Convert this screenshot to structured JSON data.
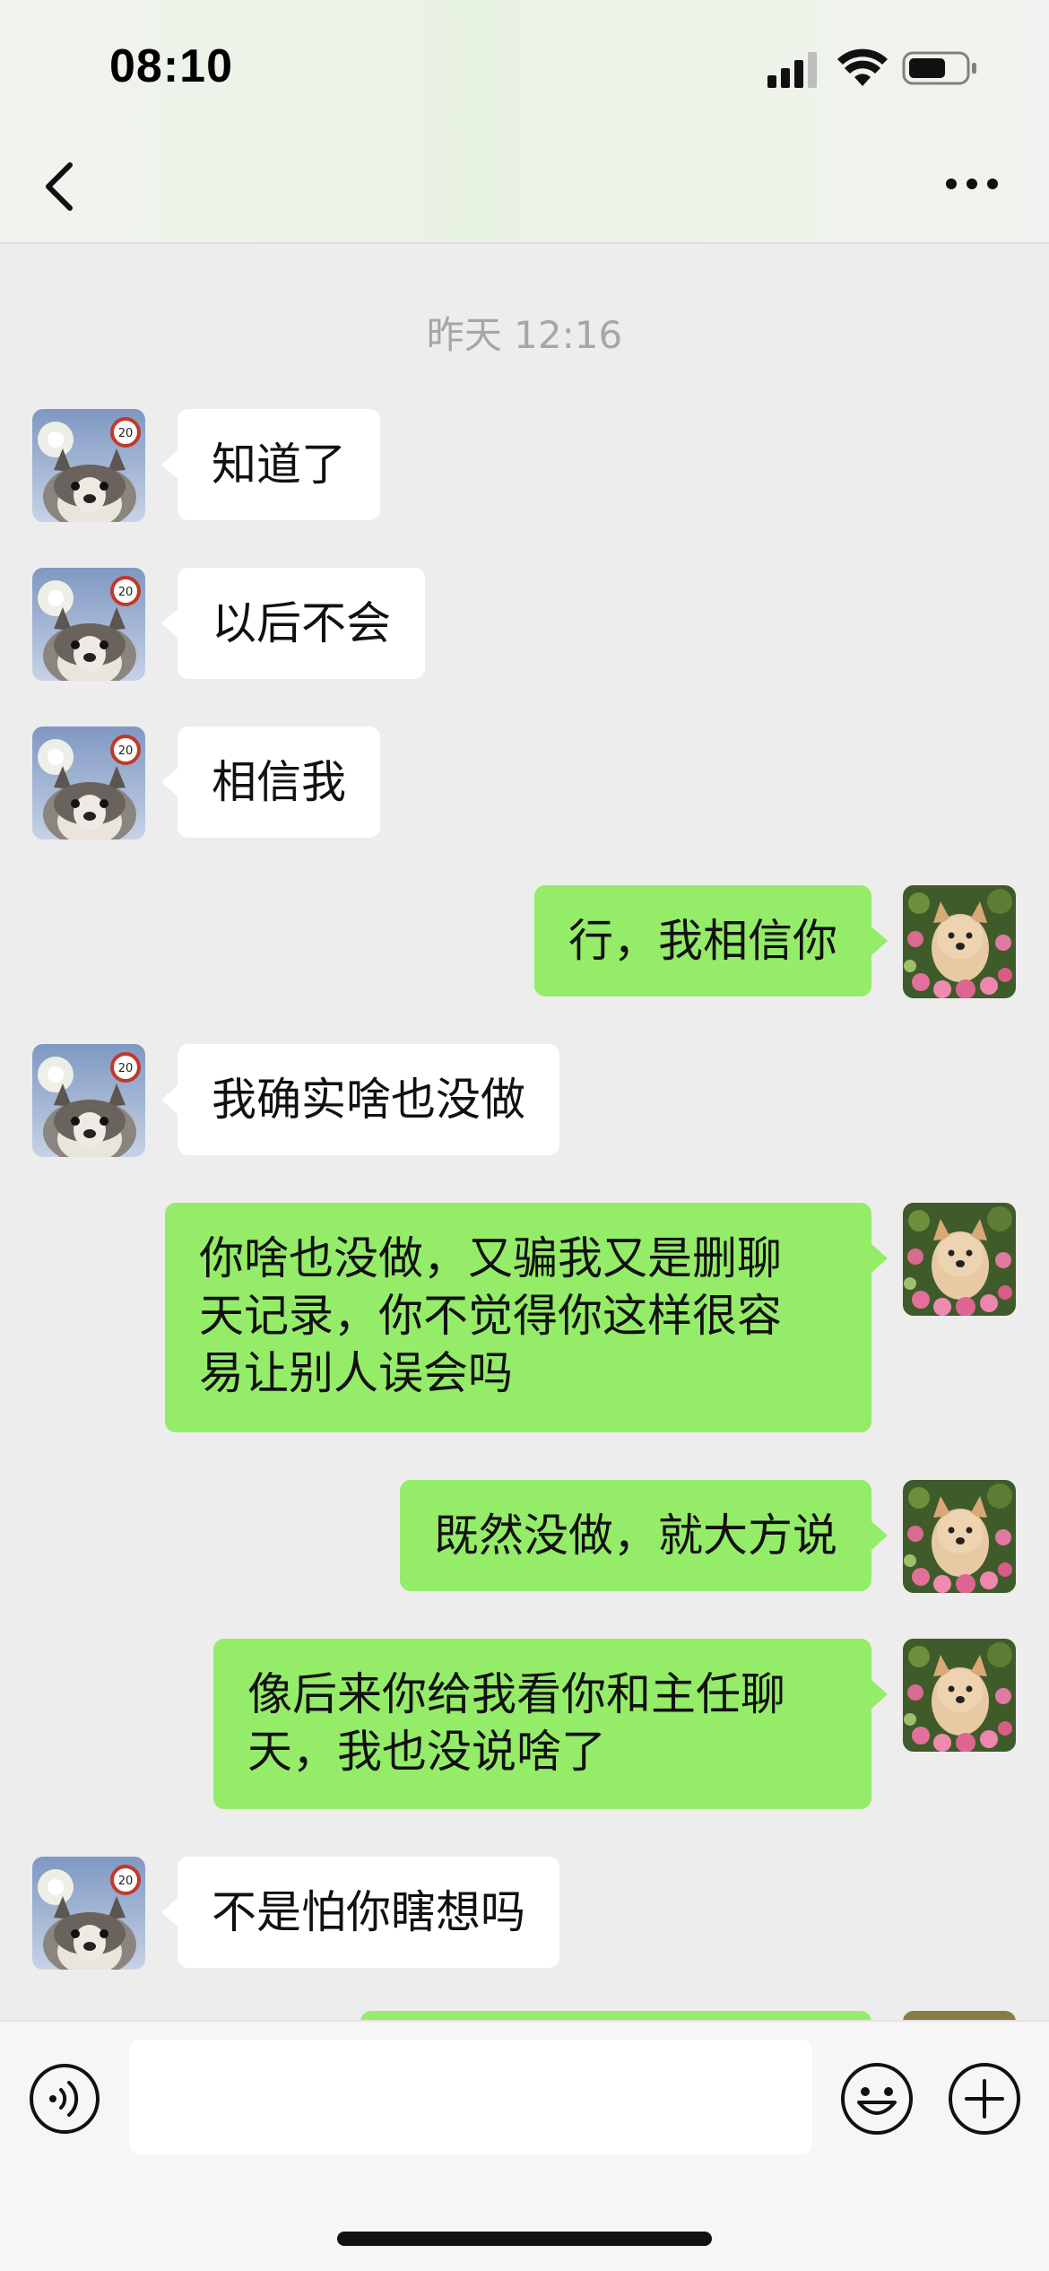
{
  "status_bar": {
    "time": "08:10",
    "icons": [
      "cellular-signal-icon",
      "wifi-icon",
      "battery-icon"
    ]
  },
  "nav": {
    "back_icon": "chevron-left-icon",
    "more_icon": "more-dots-icon"
  },
  "chat": {
    "timestamp": "昨天 12:16",
    "messages": [
      {
        "side": "in",
        "text": "知道了"
      },
      {
        "side": "in",
        "text": "以后不会"
      },
      {
        "side": "in",
        "text": "相信我"
      },
      {
        "side": "out",
        "text": "行，我相信你"
      },
      {
        "side": "in",
        "text": "我确实啥也没做"
      },
      {
        "side": "out",
        "text": "你啥也没做，又骗我又是删聊\n天记录，你不觉得你这样很容\n易让别人误会吗"
      },
      {
        "side": "out",
        "text": "既然没做，就大方说"
      },
      {
        "side": "out",
        "text": "像后来你给我看你和主任聊\n天，我也没说啥了"
      },
      {
        "side": "in",
        "text": "不是怕你瞎想吗"
      }
    ]
  },
  "input_bar": {
    "voice_icon": "voice-icon",
    "input_value": "",
    "emoji_icon": "emoji-icon",
    "add_icon": "plus-icon"
  },
  "colors": {
    "background": "#ededed",
    "incoming_bubble": "#ffffff",
    "outgoing_bubble": "#95ec69",
    "timestamp": "#a6a6a6"
  }
}
